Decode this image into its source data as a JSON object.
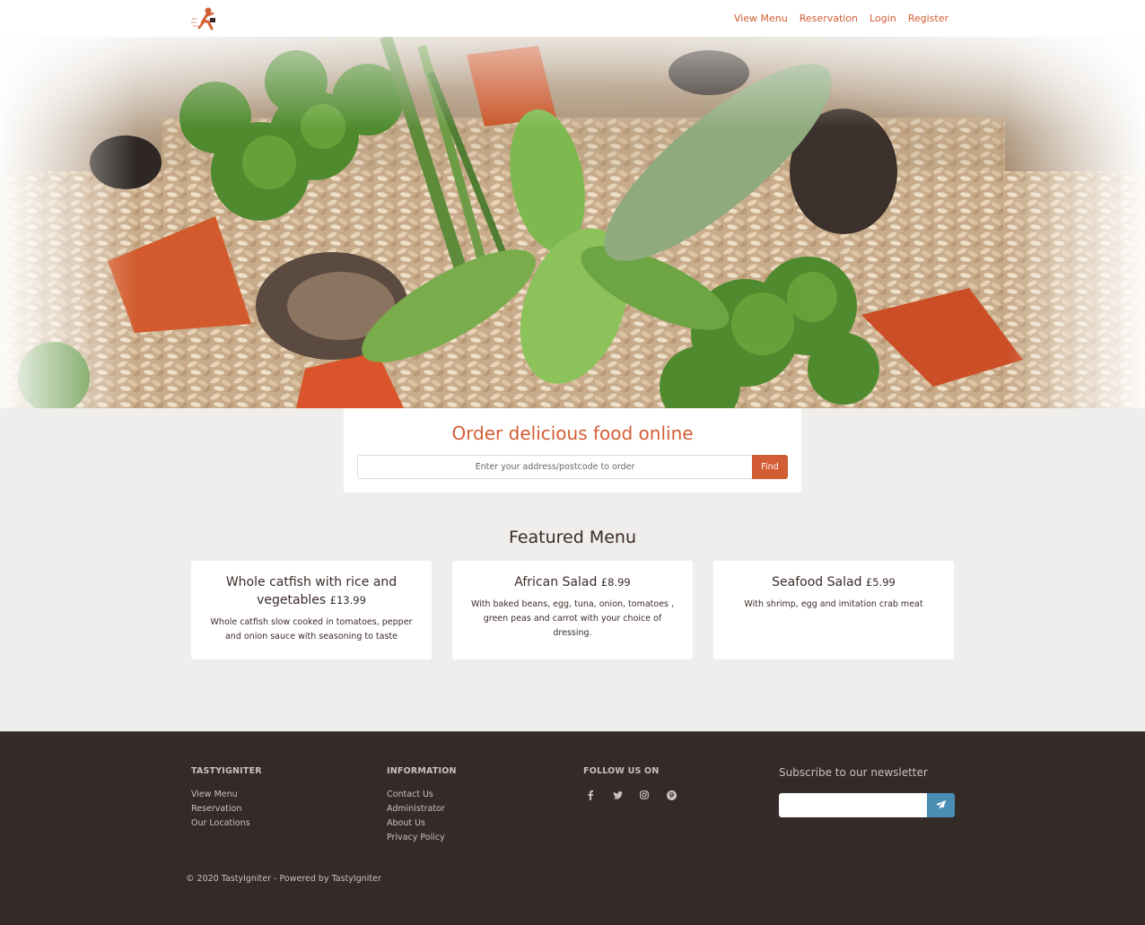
{
  "header": {
    "nav": [
      "View Menu",
      "Reservation",
      "Login",
      "Register"
    ]
  },
  "order": {
    "title": "Order delicious food online",
    "placeholder": "Enter your address/postcode to order",
    "button": "Find"
  },
  "featured": {
    "title": "Featured Menu",
    "items": [
      {
        "name": "Whole catfish with rice and vegetables",
        "price": "£13.99",
        "description": "Whole catfish slow cooked in tomatoes, pepper and onion sauce with seasoning to taste"
      },
      {
        "name": "African Salad",
        "price": "£8.99",
        "description": "With baked beans, egg, tuna, onion, tomatoes , green peas and carrot with your choice of dressing."
      },
      {
        "name": "Seafood Salad",
        "price": "£5.99",
        "description": "With shrimp, egg and imitation crab meat"
      }
    ]
  },
  "footer": {
    "col1": {
      "title": "TASTYIGNITER",
      "links": [
        "View Menu",
        "Reservation",
        "Our Locations"
      ]
    },
    "col2": {
      "title": "INFORMATION",
      "links": [
        "Contact Us",
        "Administrator",
        "About Us",
        "Privacy Policy"
      ]
    },
    "col3": {
      "title": "FOLLOW US ON",
      "icons": [
        "facebook-icon",
        "twitter-icon",
        "instagram-icon",
        "pinterest-icon"
      ]
    },
    "newsletter": {
      "title": "Subscribe to our newsletter",
      "placeholder": ""
    },
    "copyright": "© 2020 TastyIgniter - Powered by TastyIgniter"
  },
  "colors": {
    "accent": "#d35d34",
    "footer_bg": "#342a28",
    "newsletter_button": "#4a8eb4",
    "page_bg": "#efeeec"
  }
}
